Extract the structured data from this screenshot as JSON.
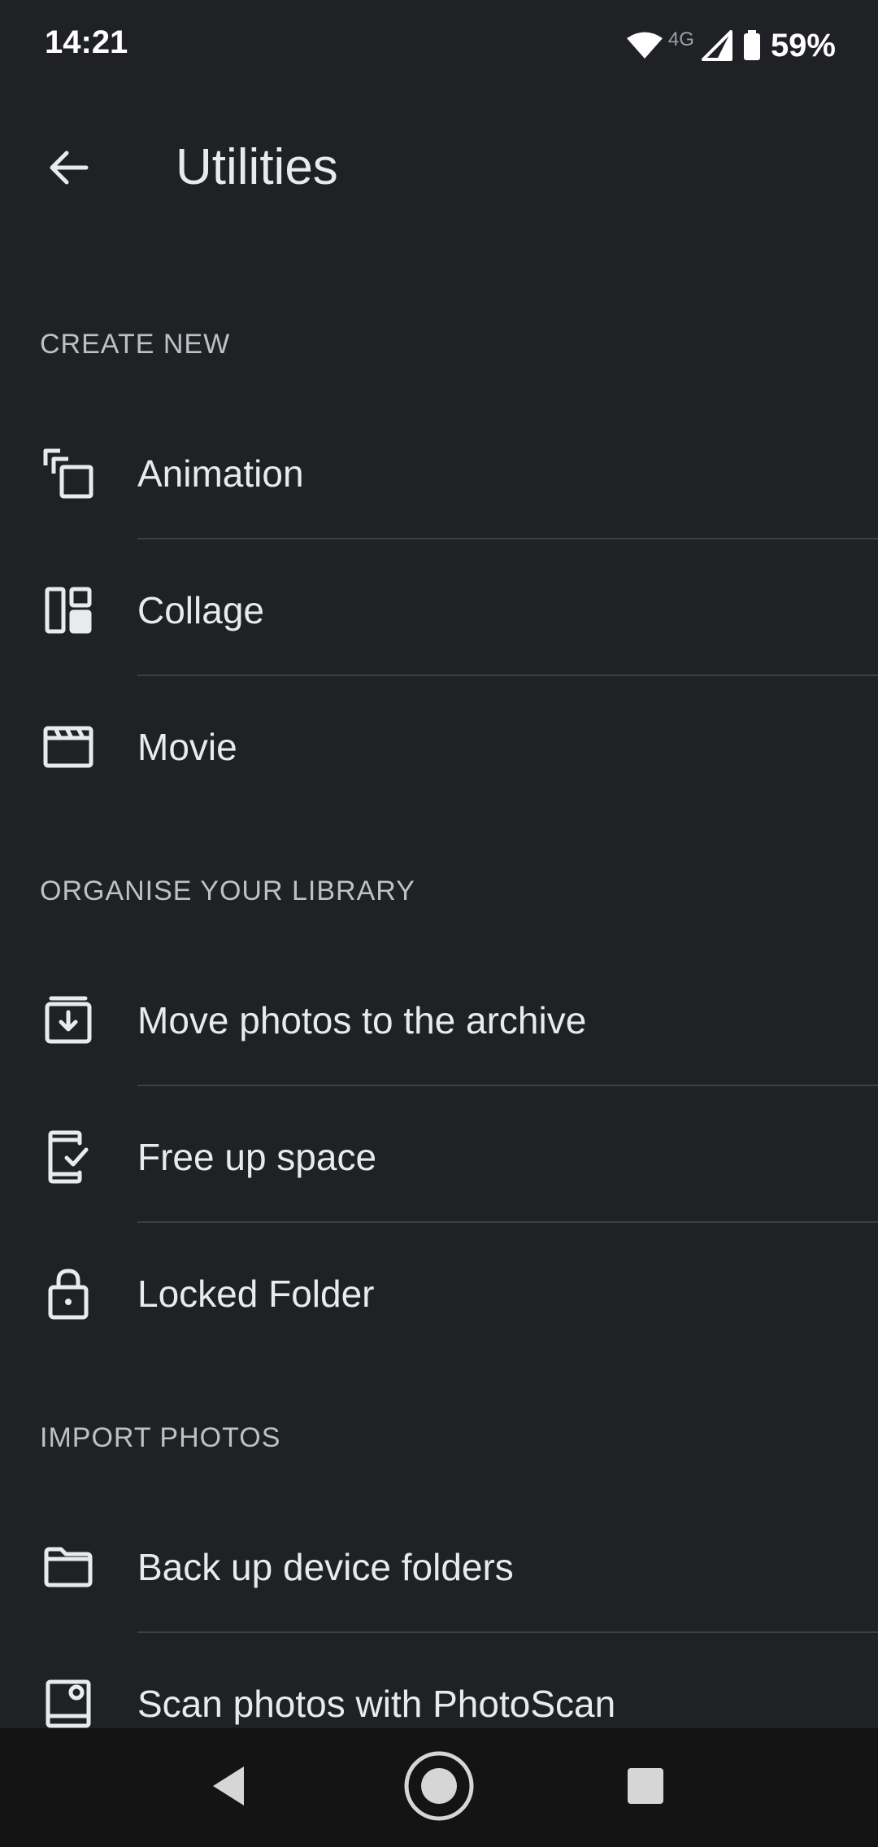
{
  "status_bar": {
    "time": "14:21",
    "network_label": "4G",
    "battery_percent": "59%"
  },
  "app_bar": {
    "title": "Utilities",
    "back_icon": "arrow-back-icon"
  },
  "sections": {
    "create_new": {
      "header": "CREATE NEW",
      "items": [
        {
          "label": "Animation",
          "icon": "animation-icon"
        },
        {
          "label": "Collage",
          "icon": "collage-icon"
        },
        {
          "label": "Movie",
          "icon": "movie-icon"
        }
      ]
    },
    "organise": {
      "header": "ORGANISE YOUR LIBRARY",
      "items": [
        {
          "label": "Move photos to the archive",
          "icon": "archive-icon"
        },
        {
          "label": "Free up space",
          "icon": "free-up-space-icon"
        },
        {
          "label": "Locked Folder",
          "icon": "lock-icon"
        }
      ]
    },
    "import": {
      "header": "IMPORT PHOTOS",
      "items": [
        {
          "label": "Back up device folders",
          "icon": "folder-icon"
        },
        {
          "label": "Scan photos with PhotoScan",
          "icon": "photoscan-icon"
        }
      ]
    }
  },
  "nav_bar": {
    "back": "nav-back-icon",
    "home": "nav-home-icon",
    "recents": "nav-recents-icon"
  },
  "colors": {
    "background": "#202124",
    "text_primary": "#e8eaed",
    "text_secondary": "#bdc1c6",
    "divider": "#3c4043",
    "nav_bar": "#141414"
  }
}
